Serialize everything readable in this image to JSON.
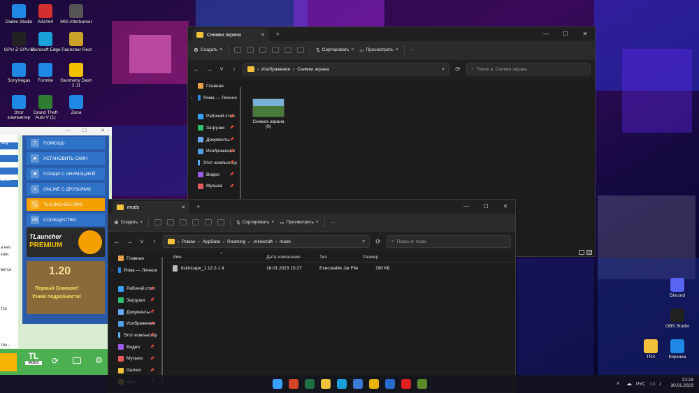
{
  "desktop_icons": [
    {
      "label": "Diablo Studio",
      "color": "#1e88e5"
    },
    {
      "label": "AIDA64",
      "color": "#d32f2f"
    },
    {
      "label": "MSI Afterburner",
      "color": "#555"
    },
    {
      "label": "GPU-Z GPU-Z",
      "color": "#222"
    },
    {
      "label": "Microsoft Edge",
      "color": "#1aa0d8"
    },
    {
      "label": "Tlauncher Rest",
      "color": "#c9a227"
    },
    {
      "label": "SonyVegas",
      "color": "#1e88e5"
    },
    {
      "label": "Fortnite",
      "color": "#1e88e5"
    },
    {
      "label": "Geometry Dash 2.11",
      "color": "#f2c200"
    },
    {
      "label": "Этот компьютер",
      "color": "#1e88e5"
    },
    {
      "label": "Grand Theft Auto V (1)",
      "color": "#2e7d32"
    },
    {
      "label": "Zona",
      "color": "#1e88e5"
    },
    {
      "label": "Discord",
      "color": "#5865f2"
    },
    {
      "label": "OBS Studio",
      "color": "#222"
    },
    {
      "label": "TRX",
      "color": "#f3c13a"
    },
    {
      "label": "Корзина",
      "color": "#1e88e5"
    }
  ],
  "launcher": {
    "buttons": [
      "ПОМОЩЬ",
      "УСТАНОВИТЬ СКИН",
      "ПЛАЩИ С АНИМАЦИЕЙ",
      "ONLINE С ДРУЗЬЯМИ",
      "TLAUNCHER.ORG",
      "СООБЩЕСТВО"
    ],
    "button_icons": [
      "?",
      "★",
      "★",
      "<",
      "TL",
      "VK"
    ],
    "premium_label": "TLauncher",
    "premium_word": "PREMIUM",
    "version": "1.20",
    "promo_line1": "Первый Снапшот!",
    "promo_line2": "Узней подробности!",
    "left_texts": [
      ".org",
      "t",
      "a.net",
      ".su",
      "а нет.",
      "книг.",
      "вется",
      "тся",
      "тво –"
    ],
    "logo": "TL",
    "logo_sub": "MODS"
  },
  "window1": {
    "tab_title": "Снимки экрана",
    "create": "Создать",
    "sort": "Сортировать",
    "view": "Просмотреть",
    "more": "···",
    "path": [
      "Изображения",
      "Снимки экрана"
    ],
    "search_placeholder": "Поиск в: Снимки экрана",
    "sidebar": [
      {
        "label": "Главная",
        "pinned": false
      },
      {
        "label": "Рома — Личное",
        "pinned": false
      },
      {
        "label": "Рабочий стол",
        "pinned": true
      },
      {
        "label": "Загрузки",
        "pinned": true
      },
      {
        "label": "Документы",
        "pinned": true
      },
      {
        "label": "Изображения",
        "pinned": true
      },
      {
        "label": "Этот компьютер",
        "pinned": true
      },
      {
        "label": "Видео",
        "pinned": true
      },
      {
        "label": "Музыка",
        "pinned": true
      }
    ],
    "file": {
      "name": "Снимок экрана",
      "sub": "(8)"
    }
  },
  "window2": {
    "tab_title": "mods",
    "create": "Создать",
    "sort": "Сортировать",
    "view": "Просмотреть",
    "more": "···",
    "path": [
      "Роман",
      "AppData",
      "Roaming",
      ".minecraft",
      "mods"
    ],
    "search_placeholder": "Поиск в: mods",
    "columns": [
      "Имя",
      "Дата изменения",
      "Тип",
      "Размер"
    ],
    "rows": [
      {
        "name": "tlskincape_1.12.2-1.4",
        "date": "16.01.2023 15:27",
        "type": "Executable Jar File",
        "size": "190 КБ"
      }
    ],
    "sidebar": [
      {
        "label": "Главная",
        "pinned": false
      },
      {
        "label": "Рома — Личное",
        "pinned": false
      },
      {
        "label": "Рабочий стол",
        "pinned": true
      },
      {
        "label": "Загрузки",
        "pinned": true
      },
      {
        "label": "Документы",
        "pinned": true
      },
      {
        "label": "Изображения",
        "pinned": true
      },
      {
        "label": "Этот компьютер",
        "pinned": true
      },
      {
        "label": "Видео",
        "pinned": true
      },
      {
        "label": "Музыка",
        "pinned": true
      },
      {
        "label": "Games",
        "pinned": true
      },
      {
        "label": "Фото",
        "pinned": true
      }
    ]
  },
  "taskbar": {
    "lang": "РУС",
    "time": "21:24",
    "date": "30.01.2023",
    "apps": [
      {
        "name": "start-icon",
        "color": "#3aa0ff"
      },
      {
        "name": "powerpoint-icon",
        "color": "#d24726"
      },
      {
        "name": "excel-icon",
        "color": "#1d6f42"
      },
      {
        "name": "file-explorer-icon",
        "color": "#f3c13a"
      },
      {
        "name": "edge-icon",
        "color": "#1aa0d8"
      },
      {
        "name": "store-icon",
        "color": "#3a7bd5"
      },
      {
        "name": "chrome-icon",
        "color": "#e8b400"
      },
      {
        "name": "mail-icon",
        "color": "#2b6cd1"
      },
      {
        "name": "youtube-icon",
        "color": "#e02020"
      },
      {
        "name": "minecraft-icon",
        "color": "#5a8a2a"
      }
    ]
  }
}
